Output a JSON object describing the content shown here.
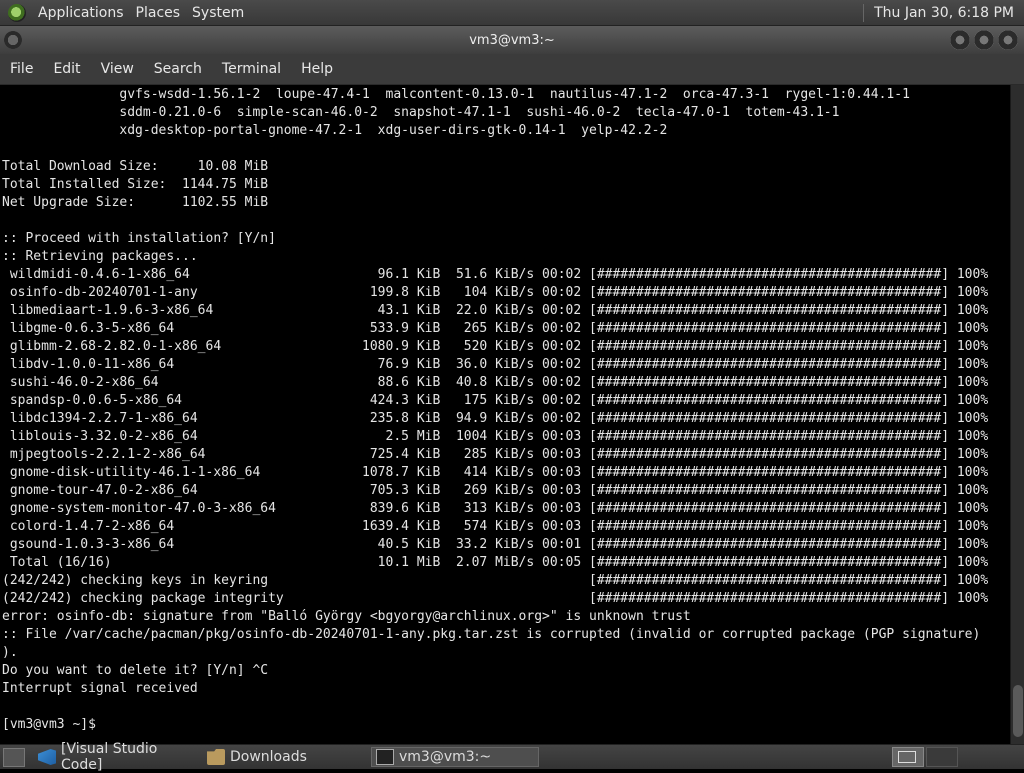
{
  "top_panel": {
    "menus": [
      "Applications",
      "Places",
      "System"
    ],
    "clock": "Thu Jan 30,  6:18 PM"
  },
  "window": {
    "title": "vm3@vm3:~",
    "menus": [
      "File",
      "Edit",
      "View",
      "Search",
      "Terminal",
      "Help"
    ]
  },
  "terminal": {
    "lines": [
      "               gvfs-wsdd-1.56.1-2  loupe-47.4-1  malcontent-0.13.0-1  nautilus-47.1-2  orca-47.3-1  rygel-1:0.44.1-1",
      "               sddm-0.21.0-6  simple-scan-46.0-2  snapshot-47.1-1  sushi-46.0-2  tecla-47.0-1  totem-43.1-1",
      "               xdg-desktop-portal-gnome-47.2-1  xdg-user-dirs-gtk-0.14-1  yelp-42.2-2",
      "",
      "Total Download Size:     10.08 MiB",
      "Total Installed Size:  1144.75 MiB",
      "Net Upgrade Size:      1102.55 MiB",
      "",
      ":: Proceed with installation? [Y/n]",
      ":: Retrieving packages...",
      " wildmidi-0.4.6-1-x86_64                        96.1 KiB  51.6 KiB/s 00:02 [############################################] 100%",
      " osinfo-db-20240701-1-any                      199.8 KiB   104 KiB/s 00:02 [############################################] 100%",
      " libmediaart-1.9.6-3-x86_64                     43.1 KiB  22.0 KiB/s 00:02 [############################################] 100%",
      " libgme-0.6.3-5-x86_64                         533.9 KiB   265 KiB/s 00:02 [############################################] 100%",
      " glibmm-2.68-2.82.0-1-x86_64                  1080.9 KiB   520 KiB/s 00:02 [############################################] 100%",
      " libdv-1.0.0-11-x86_64                          76.9 KiB  36.0 KiB/s 00:02 [############################################] 100%",
      " sushi-46.0-2-x86_64                            88.6 KiB  40.8 KiB/s 00:02 [############################################] 100%",
      " spandsp-0.0.6-5-x86_64                        424.3 KiB   175 KiB/s 00:02 [############################################] 100%",
      " libdc1394-2.2.7-1-x86_64                      235.8 KiB  94.9 KiB/s 00:02 [############################################] 100%",
      " liblouis-3.32.0-2-x86_64                        2.5 MiB  1004 KiB/s 00:03 [############################################] 100%",
      " mjpegtools-2.2.1-2-x86_64                     725.4 KiB   285 KiB/s 00:03 [############################################] 100%",
      " gnome-disk-utility-46.1-1-x86_64             1078.7 KiB   414 KiB/s 00:03 [############################################] 100%",
      " gnome-tour-47.0-2-x86_64                      705.3 KiB   269 KiB/s 00:03 [############################################] 100%",
      " gnome-system-monitor-47.0-3-x86_64            839.6 KiB   313 KiB/s 00:03 [############################################] 100%",
      " colord-1.4.7-2-x86_64                        1639.4 KiB   574 KiB/s 00:03 [############################################] 100%",
      " gsound-1.0.3-3-x86_64                          40.5 KiB  33.2 KiB/s 00:01 [############################################] 100%",
      " Total (16/16)                                  10.1 MiB  2.07 MiB/s 00:05 [############################################] 100%",
      "(242/242) checking keys in keyring                                         [############################################] 100%",
      "(242/242) checking package integrity                                       [############################################] 100%",
      "error: osinfo-db: signature from \"Balló György <bgyorgy@archlinux.org>\" is unknown trust",
      ":: File /var/cache/pacman/pkg/osinfo-db-20240701-1-any.pkg.tar.zst is corrupted (invalid or corrupted package (PGP signature)",
      ").",
      "Do you want to delete it? [Y/n] ^C",
      "Interrupt signal received",
      "",
      "[vm3@vm3 ~]$ "
    ]
  },
  "taskbar": {
    "tasks": [
      {
        "label": "[Visual Studio Code]",
        "icon": "vscode-icon",
        "active": false
      },
      {
        "label": "Downloads",
        "icon": "folder-icon",
        "active": false
      },
      {
        "label": "vm3@vm3:~",
        "icon": "terminal-icon",
        "active": true
      }
    ]
  },
  "colors": {
    "terminal_bg": "#000000",
    "terminal_fg": "#e5e5e5",
    "panel_bg": "#3b3b3b"
  }
}
